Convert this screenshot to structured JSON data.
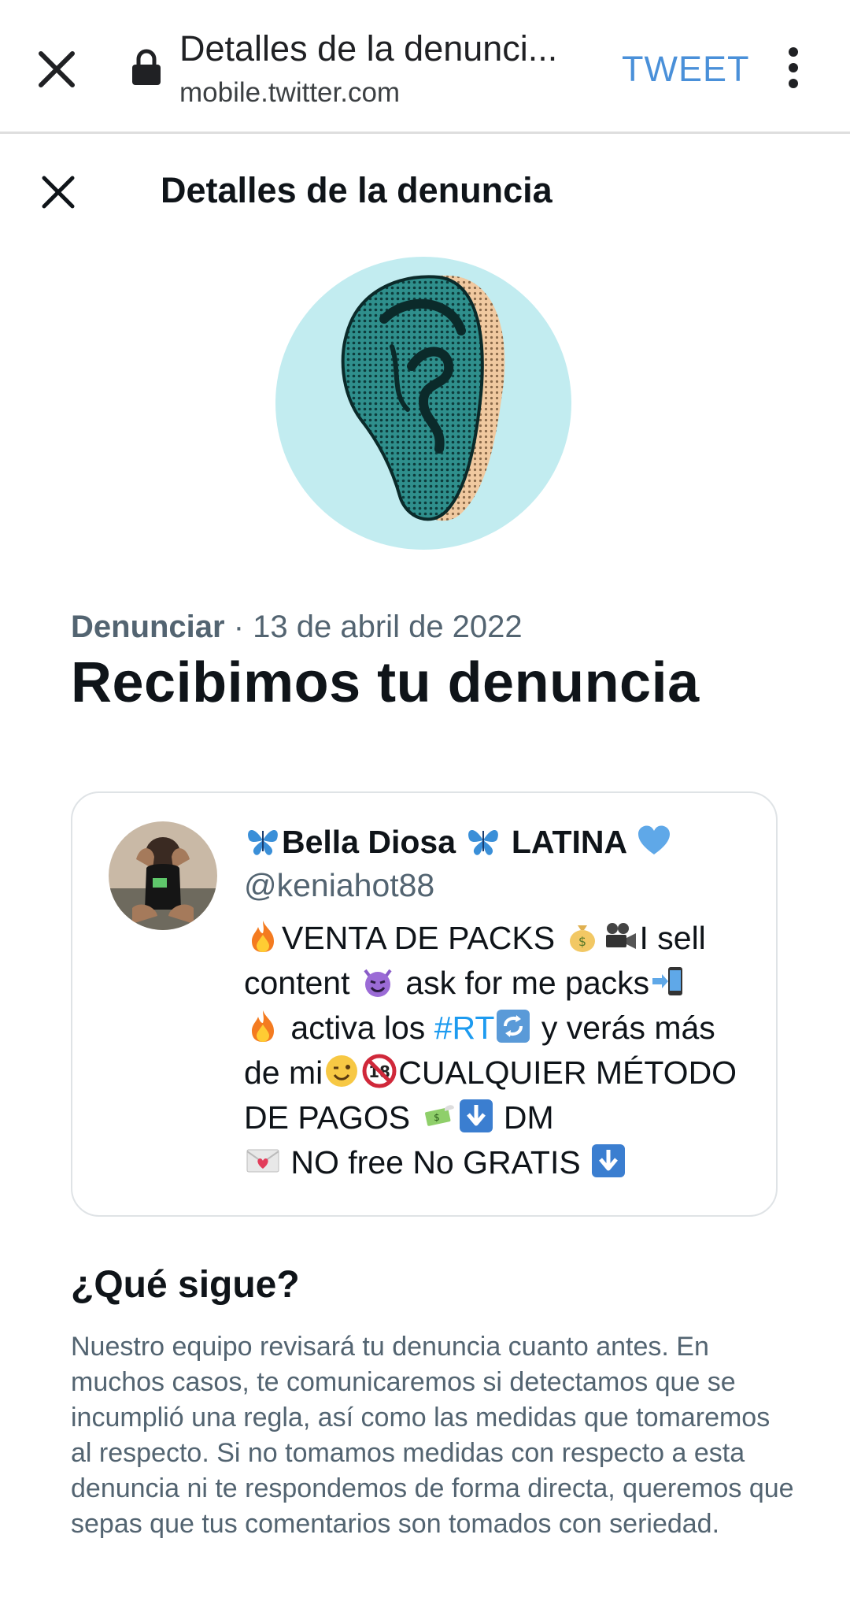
{
  "browser": {
    "title": "Detalles de la denunci...",
    "url": "mobile.twitter.com",
    "action_label": "TWEET"
  },
  "header": {
    "title": "Detalles de la denuncia"
  },
  "report": {
    "type_label": "Denunciar",
    "date_text": " · 13 de abril de 2022",
    "title": "Recibimos tu denuncia"
  },
  "tweet": {
    "name_part1": "Bella Diosa ",
    "name_part2": " LATINA ",
    "handle": "@keniahot88",
    "bio": {
      "t1": "VENTA DE PACKS ",
      "t2": "I sell content ",
      "t3": " ask for me packs",
      "t4": " activa los ",
      "hashtag": "#RT",
      "t5": " y verás más de mi",
      "t6": "CUALQUIER MÉTODO DE PAGOS ",
      "t7": " DM ",
      "t8": " NO free No GRATIS "
    }
  },
  "next_steps": {
    "title": "¿Qué sigue?",
    "body": "Nuestro equipo revisará tu denuncia cuanto antes. En muchos casos, te comunicaremos si detectamos que se incumplió una regla, así como las medidas que tomaremos al respecto. Si no tomamos medidas con respecto a esta denuncia ni te respondemos de forma directa, queremos que sepas que tus comentarios son tomados con seriedad."
  },
  "colors": {
    "accent": "#1d9bf0",
    "browser_action": "#4a90d9",
    "secondary_text": "#536471",
    "illustration_bg": "#c2ecf0"
  }
}
